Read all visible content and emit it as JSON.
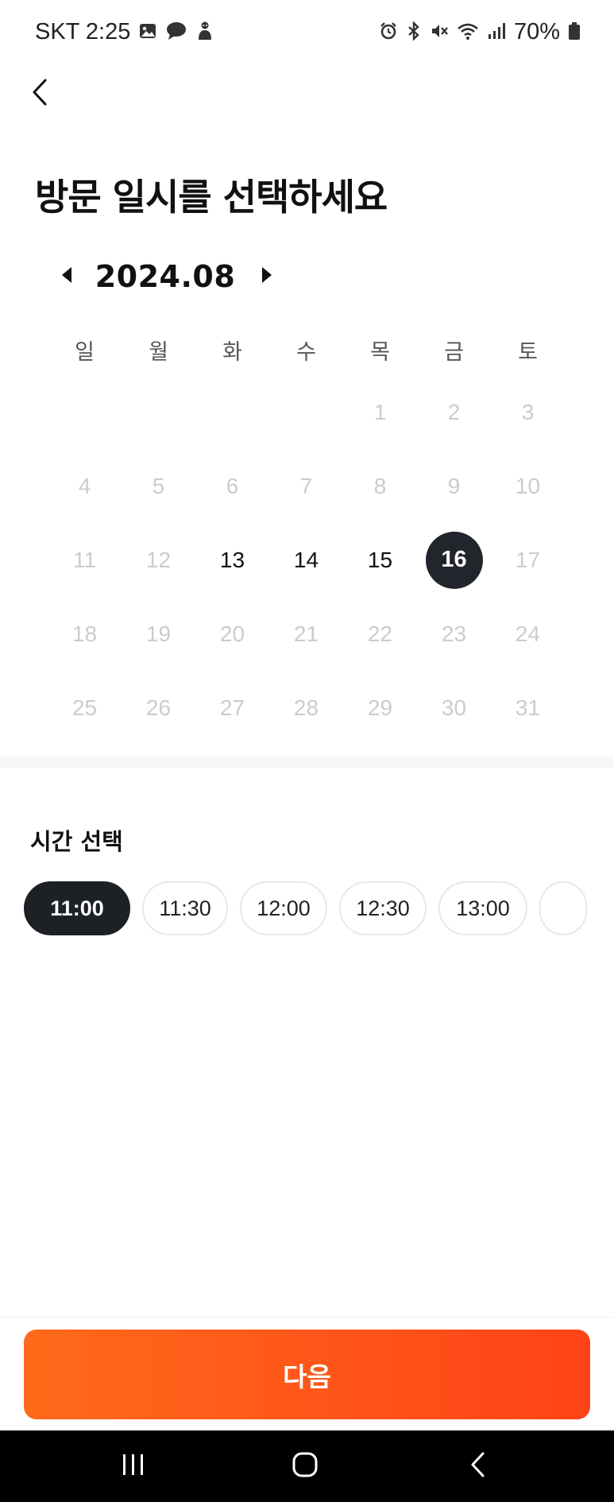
{
  "status_bar": {
    "carrier_time": "SKT 2:25",
    "battery": "70%",
    "left_icons": [
      "gallery-icon",
      "chat-icon",
      "figure-icon"
    ],
    "right_icons": [
      "alarm-icon",
      "bluetooth-icon",
      "mute-icon",
      "wifi-icon",
      "signal-icon",
      "battery-icon"
    ]
  },
  "header": {
    "back_icon": "chevron-left-icon",
    "title": "방문 일시를 선택하세요"
  },
  "calendar": {
    "month_label": "2024.08",
    "weekdays": [
      "일",
      "월",
      "화",
      "수",
      "목",
      "금",
      "토"
    ],
    "weeks": [
      [
        "",
        "",
        "",
        "",
        "1",
        "2",
        "3"
      ],
      [
        "4",
        "5",
        "6",
        "7",
        "8",
        "9",
        "10"
      ],
      [
        "11",
        "12",
        "13",
        "14",
        "15",
        "16",
        "17"
      ],
      [
        "18",
        "19",
        "20",
        "21",
        "22",
        "23",
        "24"
      ],
      [
        "25",
        "26",
        "27",
        "28",
        "29",
        "30",
        "31"
      ]
    ],
    "available_days": [
      "13",
      "14",
      "15",
      "16"
    ],
    "selected_day": "16"
  },
  "time_section": {
    "title": "시간 선택",
    "slots": [
      "11:00",
      "11:30",
      "12:00",
      "12:30",
      "13:00"
    ],
    "selected": "11:00"
  },
  "footer": {
    "next_label": "다음"
  },
  "colors": {
    "accent_start": "#ff6a1a",
    "accent_end": "#ff4318",
    "selected_dark": "#22252b",
    "disabled": "#c9ccd1"
  }
}
